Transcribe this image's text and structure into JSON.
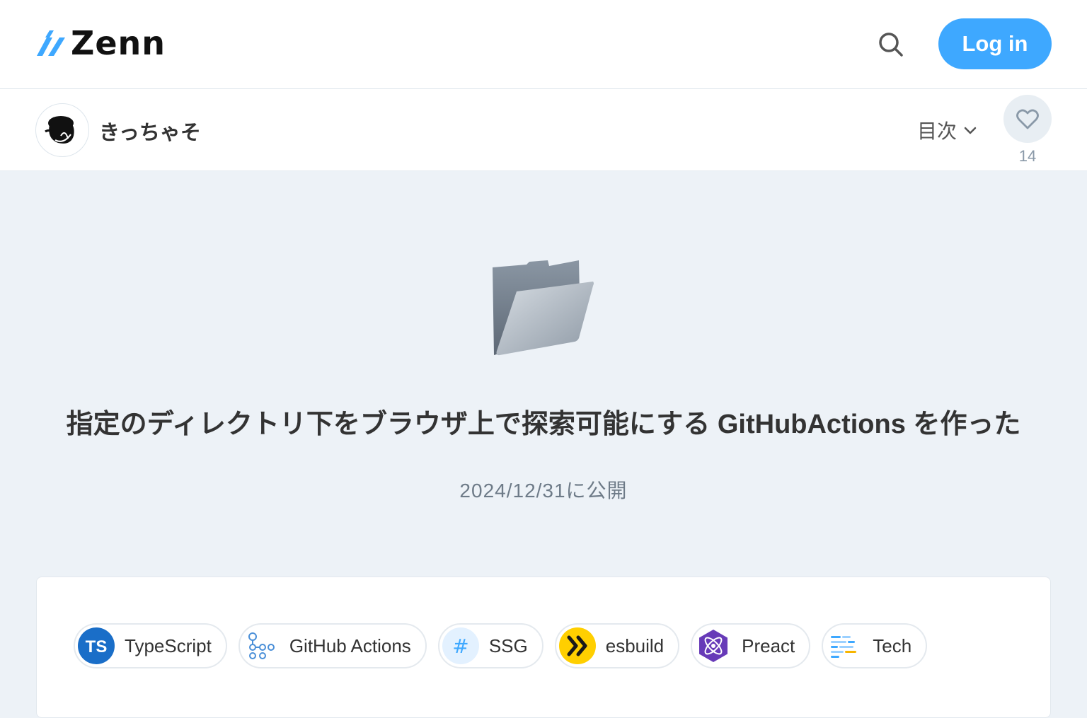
{
  "header": {
    "logo_text": "Zenn",
    "login_label": "Log in"
  },
  "author": {
    "name": "きっちゃそ"
  },
  "toolbar": {
    "toc_label": "目次",
    "like_count": "14"
  },
  "article": {
    "emoji": "folder",
    "title": "指定のディレクトリ下をブラウザ上で探索可能にする GitHubActions を作った",
    "published": "2024/12/31に公開"
  },
  "tags": [
    {
      "label": "TypeScript",
      "icon": "typescript-icon"
    },
    {
      "label": "GitHub Actions",
      "icon": "github-actions-icon"
    },
    {
      "label": "SSG",
      "icon": "hash-icon"
    },
    {
      "label": "esbuild",
      "icon": "esbuild-icon"
    },
    {
      "label": "Preact",
      "icon": "preact-icon"
    },
    {
      "label": "Tech",
      "icon": "tech-icon"
    }
  ],
  "colors": {
    "accent": "#3ea8ff",
    "background": "#edf2f7"
  }
}
